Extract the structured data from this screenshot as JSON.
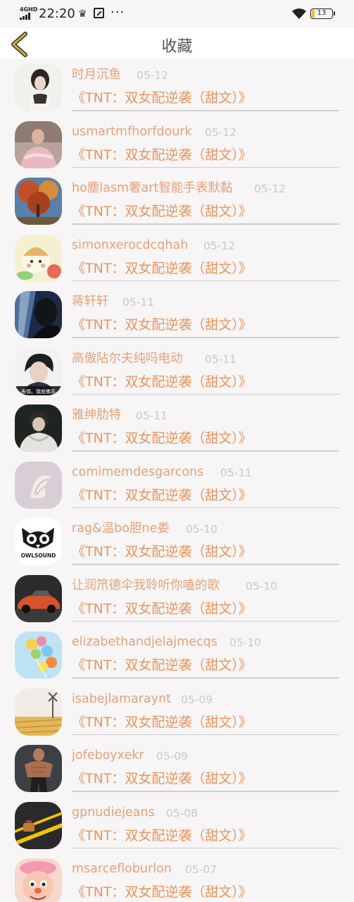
{
  "status_bar": {
    "network": "4GHD",
    "time": "22:20",
    "more": "···",
    "battery": "13",
    "icons": [
      "signal-icon",
      "crown-icon",
      "nfc-icon",
      "more-dots-icon",
      "wifi-icon",
      "battery-icon"
    ]
  },
  "header": {
    "title": "收藏",
    "back_icon": "chevron-left-icon",
    "back_color": "#c9a93a"
  },
  "colors": {
    "name": "#e3a27a",
    "book": "#e8955e",
    "date": "#c9c9c9"
  },
  "favorites": [
    {
      "name": "时月沉鱼",
      "date": "05-12",
      "book": "《TNT：双女配逆袭（甜文）》"
    },
    {
      "name": "usmartmfhorfdourk",
      "date": "05-12",
      "book": "《TNT：双女配逆袭（甜文）》"
    },
    {
      "name": "ho塵lasm奢art智能手表默黏",
      "date": "05-12",
      "book": "《TNT：双女配逆袭（甜文）》"
    },
    {
      "name": "simonxerocdcqhah",
      "date": "05-12",
      "book": "《TNT：双女配逆袭（甜文）》"
    },
    {
      "name": "蒋轩轩",
      "date": "05-11",
      "book": "《TNT：双女配逆袭（甜文）》"
    },
    {
      "name": "高傲阽尔夫纯吗电动",
      "date": "05-11",
      "book": "《TNT：双女配逆袭（甜文）》"
    },
    {
      "name": "雅绅肋特",
      "date": "05-11",
      "book": "《TNT：双女配逆袭（甜文）》"
    },
    {
      "name": "comimemdesgarcons",
      "date": "05-11",
      "book": "《TNT：双女配逆袭（甜文）》"
    },
    {
      "name": "rag&温bo胆ne娄",
      "date": "05-10",
      "book": "《TNT：双女配逆袭（甜文）》"
    },
    {
      "name": "让润笊德伞我聆听你嗑的歌",
      "date": "05-10",
      "book": "《TNT：双女配逆袭（甜文）》"
    },
    {
      "name": "elizabethandjelajmecqs",
      "date": "05-10",
      "book": "《TNT：双女配逆袭（甜文）》"
    },
    {
      "name": "isabejlamaraynt",
      "date": "05-09",
      "book": "《TNT：双女配逆袭（甜文）》"
    },
    {
      "name": "jofeboyxekr",
      "date": "05-09",
      "book": "《TNT：双女配逆袭（甜文）》"
    },
    {
      "name": "gpnudiejeans",
      "date": "05-08",
      "book": "《TNT：双女配逆袭（甜文）》"
    },
    {
      "name": "msarcefloburlon",
      "date": "05-07",
      "book": "《TNT：双女配逆袭（甜文）》"
    }
  ],
  "avatar_texts": {
    "a5": "表情。我就佛系",
    "a8": "OWLSOUND"
  }
}
